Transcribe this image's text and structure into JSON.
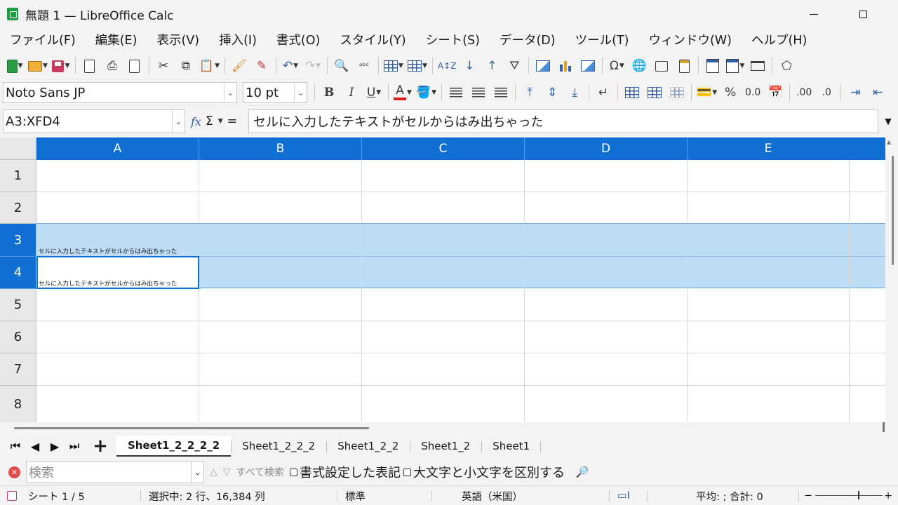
{
  "window": {
    "title": "無題 1 — LibreOffice Calc",
    "app_icon": "calc-icon",
    "minimize_icon": "minimize-icon",
    "maximize_icon": "maximize-icon"
  },
  "menu": [
    "ファイル(F)",
    "編集(E)",
    "表示(V)",
    "挿入(I)",
    "書式(O)",
    "スタイル(Y)",
    "シート(S)",
    "データ(D)",
    "ツール(T)",
    "ウィンドウ(W)",
    "ヘルプ(H)"
  ],
  "formatting": {
    "font_name": "Noto Sans JP",
    "font_size": "10 pt",
    "bold": "B",
    "italic": "I",
    "underline": "U",
    "font_color_glyph": "A",
    "font_color": "#e01b1b",
    "percent": "%",
    "decimal_standard": "0.0",
    "add_decimal": ".00",
    "delete_decimal": ".0"
  },
  "formula_bar": {
    "name_box": "A3:XFD4",
    "fx": "fx",
    "sum": "Σ",
    "equals": "=",
    "content": "セルに入力したテキストがセルからはみ出ちゃった"
  },
  "grid": {
    "columns": [
      "A",
      "B",
      "C",
      "D",
      "E"
    ],
    "rows": [
      "1",
      "2",
      "3",
      "4",
      "5",
      "6",
      "7",
      "8"
    ],
    "selected_rows": [
      "3",
      "4"
    ],
    "cells": {
      "A3": "セルに入力したテキストがセルからはみ出ちゃった",
      "A4": "セルに入力したテキストがセルからはみ出ちゃった"
    },
    "header_color": "#0f6fd3",
    "selection_color": "#bddcf5"
  },
  "sheet_tabs": {
    "add_label": "+",
    "tabs": [
      "Sheet1_2_2_2_2",
      "Sheet1_2_2_2",
      "Sheet1_2_2",
      "Sheet1_2",
      "Sheet1"
    ],
    "active": "Sheet1_2_2_2_2"
  },
  "find_bar": {
    "placeholder": "検索",
    "find_all": "すべて検索",
    "formatted_display": "書式設定した表記",
    "match_case": "大文字と小文字を区別する"
  },
  "status_bar": {
    "sheet": "シート 1 / 5",
    "selection": "選択中: 2 行、16,384 列",
    "page_style": "標準",
    "language": "英語（米国）",
    "summary": "平均: ; 合計: 0",
    "zoom_minus": "−",
    "zoom_plus": "+"
  }
}
